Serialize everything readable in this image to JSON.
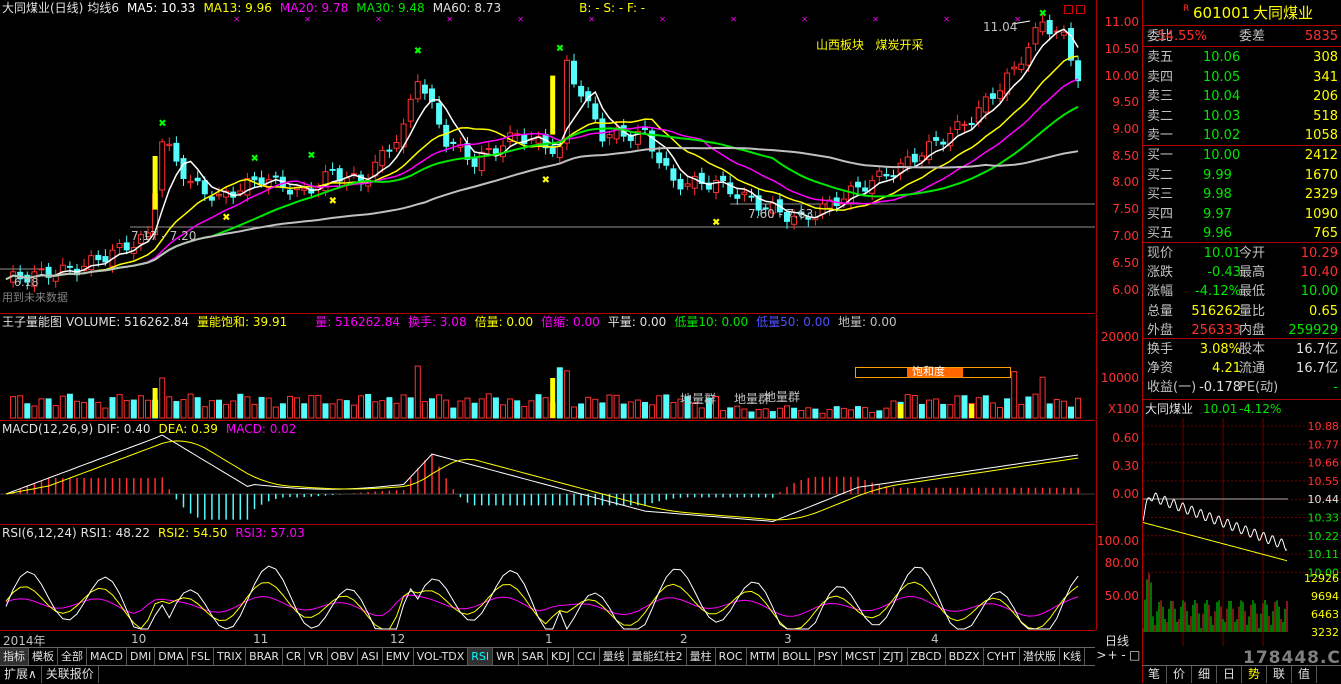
{
  "chart_title": {
    "name": "大同煤业(日线)",
    "ma_label": "均线6",
    "ma5": "MA5: 10.33",
    "ma13": "MA13: 9.96",
    "ma20": "MA20: 9.78",
    "ma30": "MA30: 9.48",
    "ma60": "MA60: 8.73",
    "bsf": "B: -  S: -  F: -"
  },
  "annotations": {
    "sector": "山西板块",
    "concept": "煤炭开采",
    "high_price": "11.04",
    "low_range": "7.60 - 7.63",
    "mid_label": "7.17 - 7.20",
    "start_price": "6.18",
    "ref_text": "用到未来数据",
    "saturation": "饱和度",
    "di_liang_1": "地量群",
    "di_liang_2": "地量群",
    "di_liang_3": "地量群"
  },
  "price_axis": [
    "11.00",
    "10.50",
    "10.00",
    "9.50",
    "9.00",
    "8.50",
    "8.00",
    "7.50",
    "7.00",
    "6.50",
    "6.00"
  ],
  "volume_header": {
    "name": "王子量能图",
    "volume": "VOLUME: 516262.84",
    "saturation": "量能饱和: 39.91",
    "liang": "量: 516262.84",
    "huanshou": "换手: 3.08",
    "beiliang": "倍量: 0.00",
    "beisuo": "倍缩: 0.00",
    "pingliang": "平量: 0.00",
    "diliang10": "低量10: 0.00",
    "diliang50": "低量50: 0.00",
    "diliang": "地量: 0.00"
  },
  "volume_axis": [
    "20000",
    "10000",
    "X100"
  ],
  "macd_header": {
    "name": "MACD(12,26,9)",
    "dif": "DIF: 0.40",
    "dea": "DEA: 0.39",
    "macd": "MACD: 0.02"
  },
  "macd_axis": [
    "0.60",
    "0.30",
    "0.00"
  ],
  "rsi_header": {
    "name": "RSI(6,12,24)",
    "rsi1": "RSI1: 48.22",
    "rsi2": "RSI2: 54.50",
    "rsi3": "RSI3: 57.03"
  },
  "rsi_axis": [
    "100.00",
    "80.00",
    "50.00"
  ],
  "x_axis": [
    "2014年",
    "10",
    "11",
    "12",
    "1",
    "2",
    "3",
    "4"
  ],
  "tabs": [
    "指标",
    "模板",
    "全部",
    "MACD",
    "DMI",
    "DMA",
    "FSL",
    "TRIX",
    "BRAR",
    "CR",
    "VR",
    "OBV",
    "ASI",
    "EMV",
    "VOL-TDX",
    "RSI",
    "WR",
    "SAR",
    "KDJ",
    "CCI",
    "量线",
    "量能红柱2",
    "量柱",
    "ROC",
    "MTM",
    "BOLL",
    "PSY",
    "MCST",
    "ZJTJ",
    "ZBCD",
    "BDZX",
    "CYHT",
    "潜伏版",
    "K线"
  ],
  "active_tab": "RSI",
  "tab_controls": [
    ">",
    "+",
    "-",
    "□"
  ],
  "bottom_tabs": [
    "扩展∧",
    "关联报价"
  ],
  "quote": {
    "flag": "R",
    "code": "601001",
    "name": "大同煤业",
    "weibi_label": "委比",
    "weibi": "54.55%",
    "weicha_label": "委差",
    "weicha": "5835",
    "asks": [
      {
        "label": "卖五",
        "price": "10.06",
        "vol": "308"
      },
      {
        "label": "卖四",
        "price": "10.05",
        "vol": "341"
      },
      {
        "label": "卖三",
        "price": "10.04",
        "vol": "206"
      },
      {
        "label": "卖二",
        "price": "10.03",
        "vol": "518"
      },
      {
        "label": "卖一",
        "price": "10.02",
        "vol": "1058"
      }
    ],
    "bids": [
      {
        "label": "买一",
        "price": "10.00",
        "vol": "2412"
      },
      {
        "label": "买二",
        "price": "9.99",
        "vol": "1670"
      },
      {
        "label": "买三",
        "price": "9.98",
        "vol": "2329"
      },
      {
        "label": "买四",
        "price": "9.97",
        "vol": "1090"
      },
      {
        "label": "买五",
        "price": "9.96",
        "vol": "765"
      }
    ],
    "stats": [
      {
        "l1": "现价",
        "v1": "10.01",
        "l2": "今开",
        "v2": "10.29"
      },
      {
        "l1": "涨跌",
        "v1": "-0.43",
        "l2": "最高",
        "v2": "10.40"
      },
      {
        "l1": "涨幅",
        "v1": "-4.12%",
        "l2": "最低",
        "v2": "10.00"
      },
      {
        "l1": "总量",
        "v1": "516262",
        "l2": "量比",
        "v2": "0.65"
      },
      {
        "l1": "外盘",
        "v1": "256333",
        "l2": "内盘",
        "v2": "259929"
      }
    ],
    "stats2": [
      {
        "l1": "换手",
        "v1": "3.08%",
        "l2": "股本",
        "v2": "16.7亿"
      },
      {
        "l1": "净资",
        "v1": "4.21",
        "l2": "流通",
        "v2": "16.7亿"
      },
      {
        "l1": "收益(一)",
        "v1": "-0.178",
        "l2": "PE(动)",
        "v2": "-"
      }
    ],
    "mini_title": "大同煤业",
    "mini_price": "10.01",
    "mini_pct": "-4.12%",
    "mini_axis": [
      "10.88",
      "10.77",
      "10.66",
      "10.55",
      "10.44",
      "10.33",
      "10.22",
      "10.11",
      "10.00"
    ],
    "mini_vol_axis": [
      "12926",
      "9694",
      "6463",
      "3232"
    ],
    "mini_xlabel": "日线",
    "side_tabs": [
      "笔",
      "价",
      "细",
      "日",
      "势",
      "联",
      "值"
    ],
    "active_side_tab": "势"
  },
  "watermark": "178448.COM",
  "colors": {
    "up": "#ff3030",
    "down": "#54fcfc",
    "ma5": "#ffffff",
    "ma13": "#ffff00",
    "ma20": "#ff00ff",
    "ma30": "#00e600",
    "ma60": "#c0c0c0"
  }
}
